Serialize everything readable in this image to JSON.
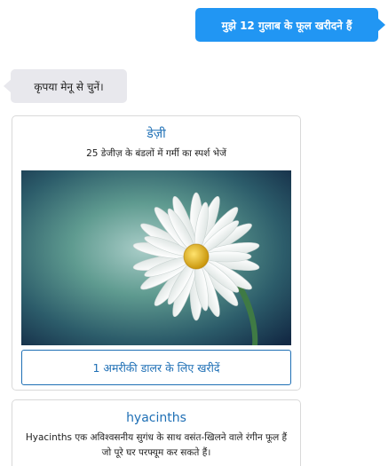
{
  "messages": {
    "user_message": "मुझे  12 गुलाब के फूल खरीदने हैं",
    "bot_message": "कृपया मेनू से चुनें।"
  },
  "products": [
    {
      "title": "डेज़ी",
      "description": "25 डेजीज़ के बंडलों में गर्मी का स्पर्श भेजें",
      "image_icon": "daisy-flower-photo",
      "button_label": "1 अमरीकी डालर के लिए खरीदें"
    },
    {
      "title": "hyacinths",
      "description": "Hyacinths एक अविश्वसनीय सुगंध के साथ वसंत-खिलने वाले रंगीन फूल हैं जो पूरे घर परफ्यूम कर सकते हैं।"
    }
  ],
  "colors": {
    "user_bubble": "#2196f3",
    "bot_bubble": "#e8e8ed",
    "link_blue": "#1e6fb5"
  }
}
